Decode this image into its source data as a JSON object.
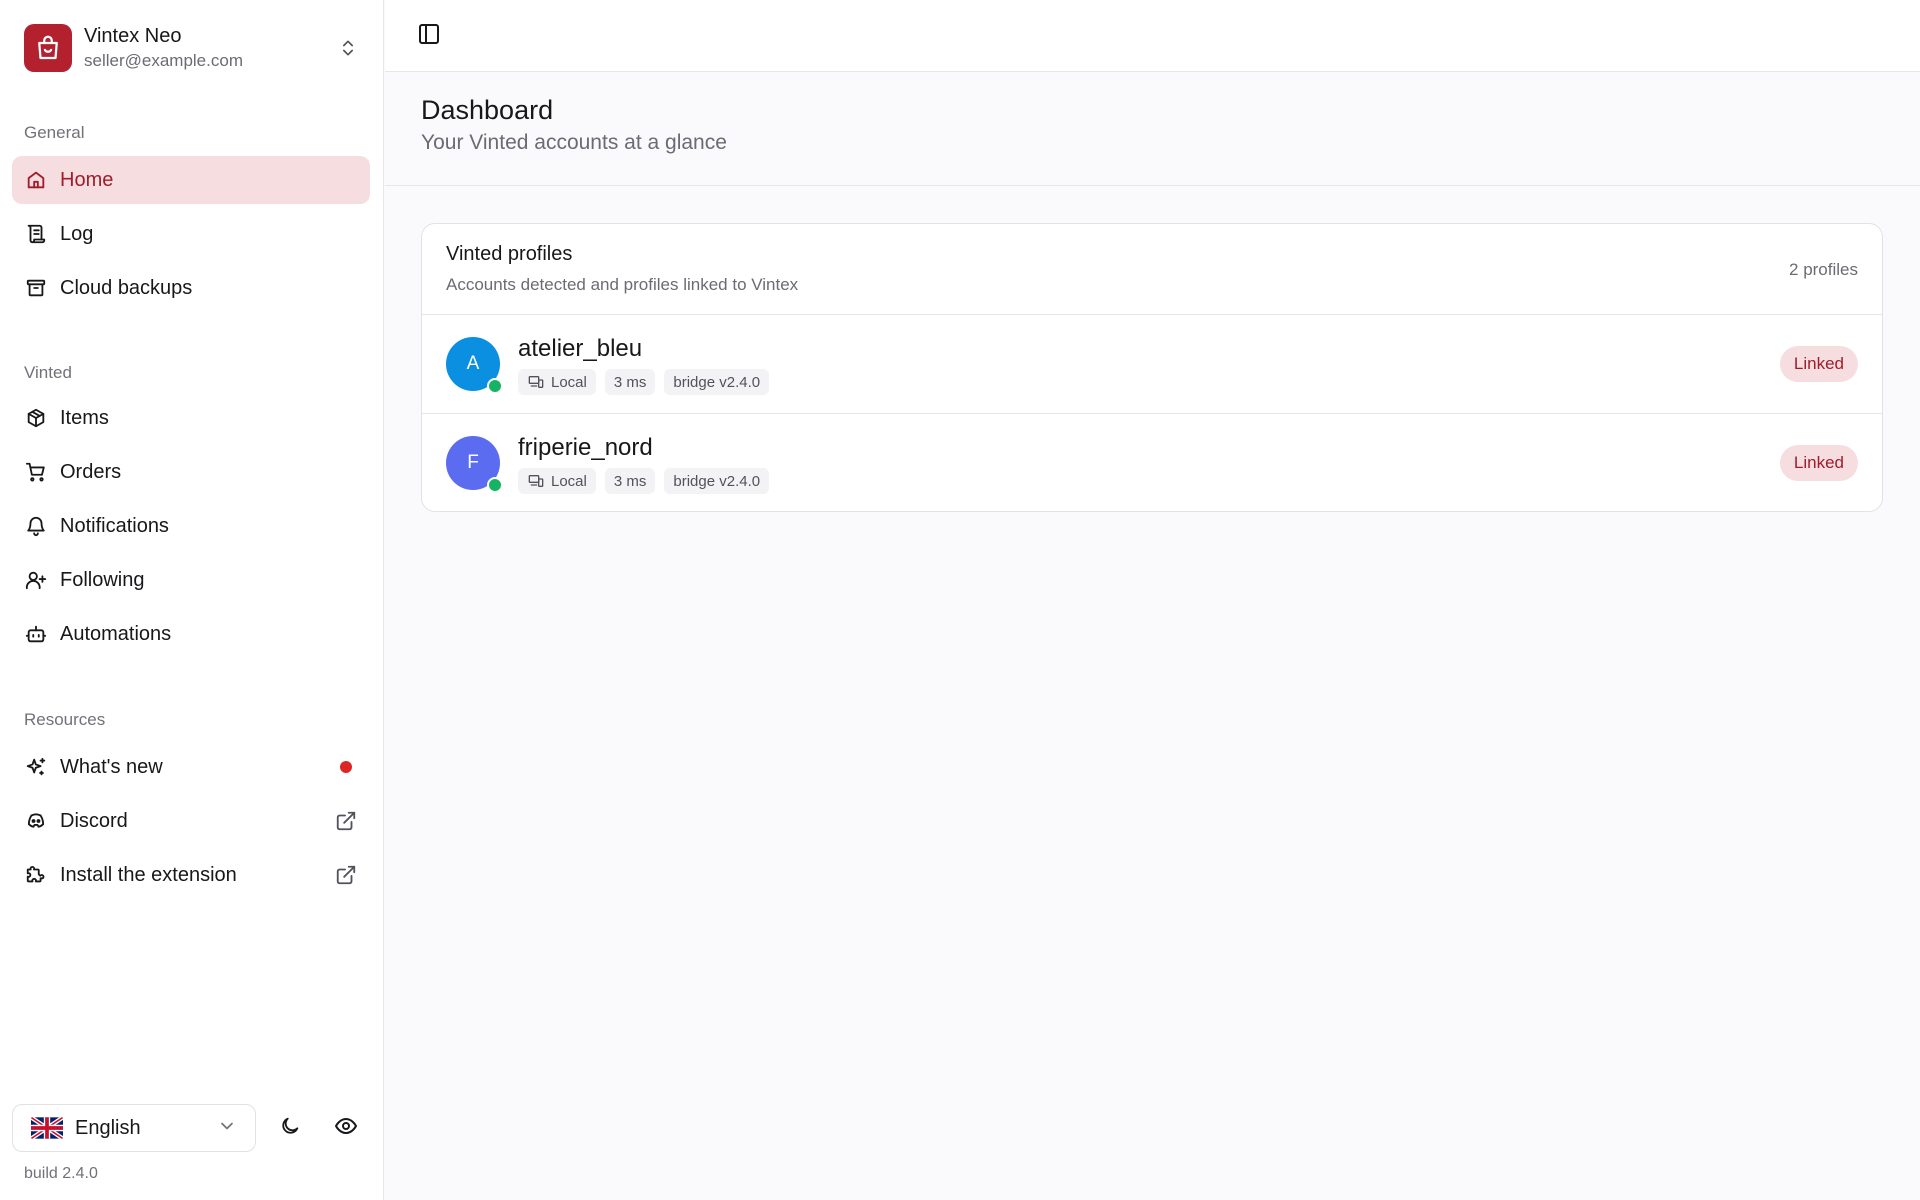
{
  "account": {
    "name": "Vintex Neo",
    "email": "seller@example.com"
  },
  "sidebar": {
    "sections": {
      "general": "General",
      "vinted": "Vinted",
      "resources": "Resources"
    },
    "items": {
      "home": "Home",
      "log": "Log",
      "cloud_backups": "Cloud backups",
      "items": "Items",
      "orders": "Orders",
      "notifications": "Notifications",
      "following": "Following",
      "automations": "Automations",
      "whats_new": "What's new",
      "discord": "Discord",
      "install_extension": "Install the extension"
    },
    "language": "English",
    "build": "build 2.4.0"
  },
  "page": {
    "title": "Dashboard",
    "subtitle": "Your Vinted accounts at a glance"
  },
  "profiles_card": {
    "title": "Vinted profiles",
    "description": "Accounts detected and profiles linked to Vintex",
    "count": "2 profiles",
    "profiles": [
      {
        "initial": "A",
        "name": "atelier_bleu",
        "source": "Local",
        "latency": "3 ms",
        "bridge": "bridge v2.4.0",
        "status": "Linked",
        "avatar_color": "#0b8fe0"
      },
      {
        "initial": "F",
        "name": "friperie_nord",
        "source": "Local",
        "latency": "3 ms",
        "bridge": "bridge v2.4.0",
        "status": "Linked",
        "avatar_color": "#5b6cf0"
      }
    ]
  },
  "colors": {
    "accent": "#b3202e",
    "active_bg": "#f6dde0",
    "online": "#16b364"
  }
}
